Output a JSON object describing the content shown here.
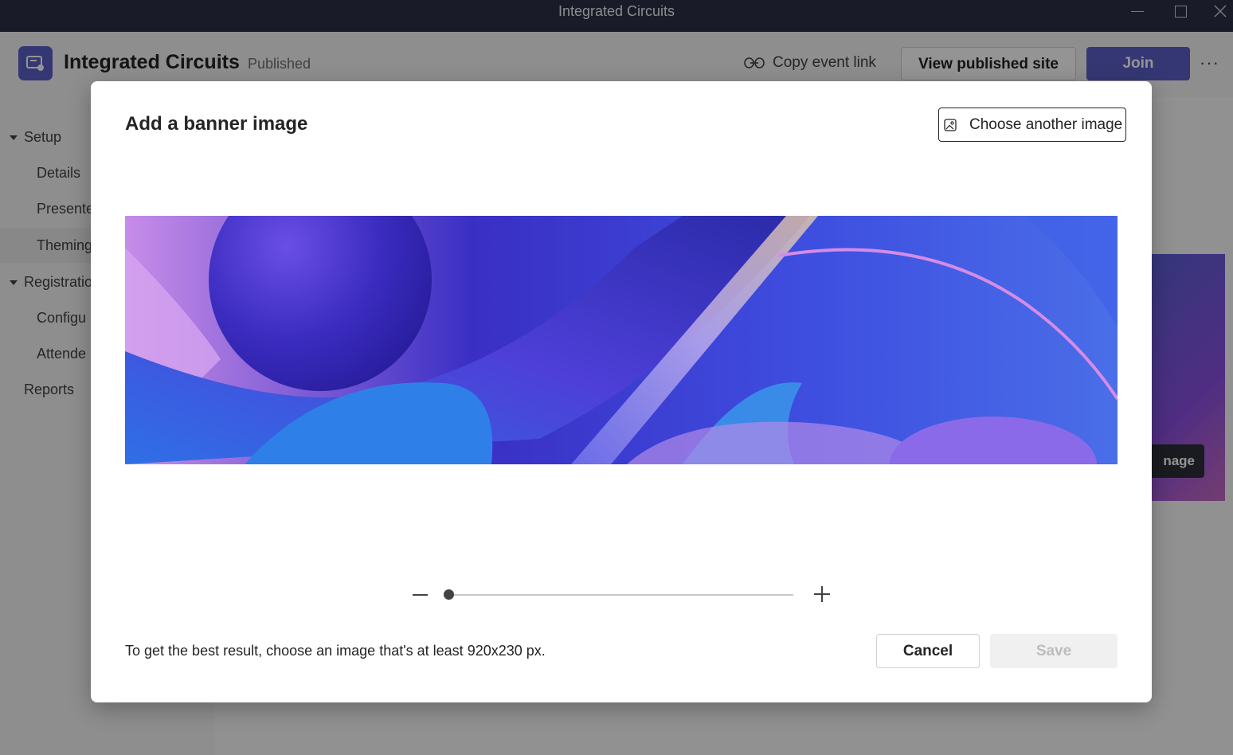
{
  "window": {
    "title": "Integrated Circuits"
  },
  "header": {
    "app_name": "Integrated Circuits",
    "status": "Published",
    "copy_link_label": "Copy event link",
    "view_site_label": "View published site",
    "join_label": "Join",
    "more_label": "···"
  },
  "nav": {
    "setup": "Setup",
    "details": "Details",
    "presenters": "Presente",
    "theming": "Theming",
    "registration": "Registratio",
    "configure": "Configu",
    "attendees": "Attende",
    "reports": "Reports"
  },
  "background": {
    "banner_button_label": "nage"
  },
  "dialog": {
    "title": "Add a banner image",
    "choose_label": "Choose another image",
    "zoom_level": 0,
    "hint": "To get the best result, choose an image that's at least 920x230 px.",
    "cancel_label": "Cancel",
    "save_label": "Save"
  },
  "colors": {
    "accent": "#5b5fc7",
    "titlebar": "#2b2f45"
  }
}
